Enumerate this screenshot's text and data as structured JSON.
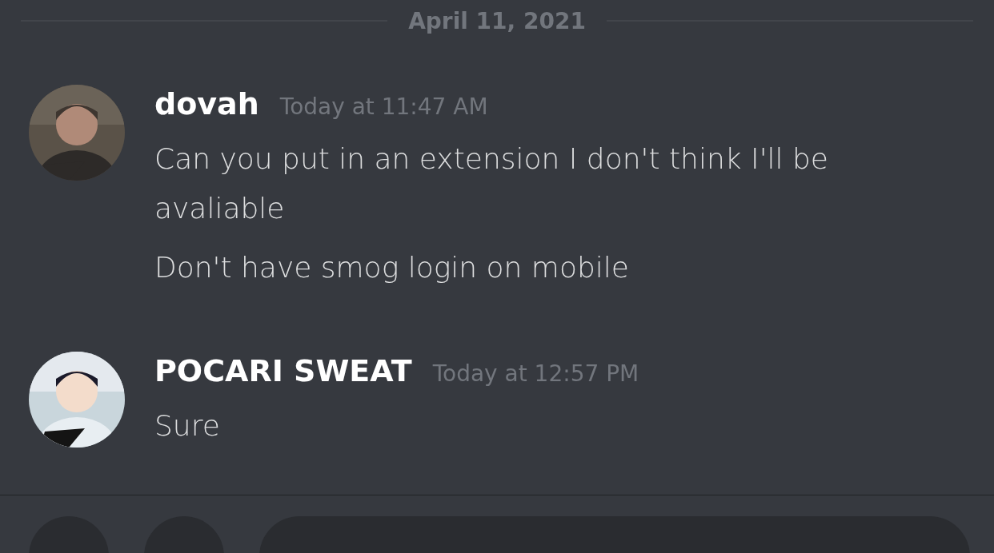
{
  "date_divider": "April 11, 2021",
  "messages": [
    {
      "author": "dovah",
      "timestamp": "Today at 11:47 AM",
      "avatar": {
        "kind": "picture"
      },
      "lines": [
        "Can you put in an extension I don't think I'll be avaliable",
        "Don't have smog login on mobile"
      ]
    },
    {
      "author": "POCARI SWEAT",
      "timestamp": "Today at 12:57 PM",
      "avatar": {
        "kind": "picture"
      },
      "lines": [
        "Sure"
      ]
    }
  ]
}
